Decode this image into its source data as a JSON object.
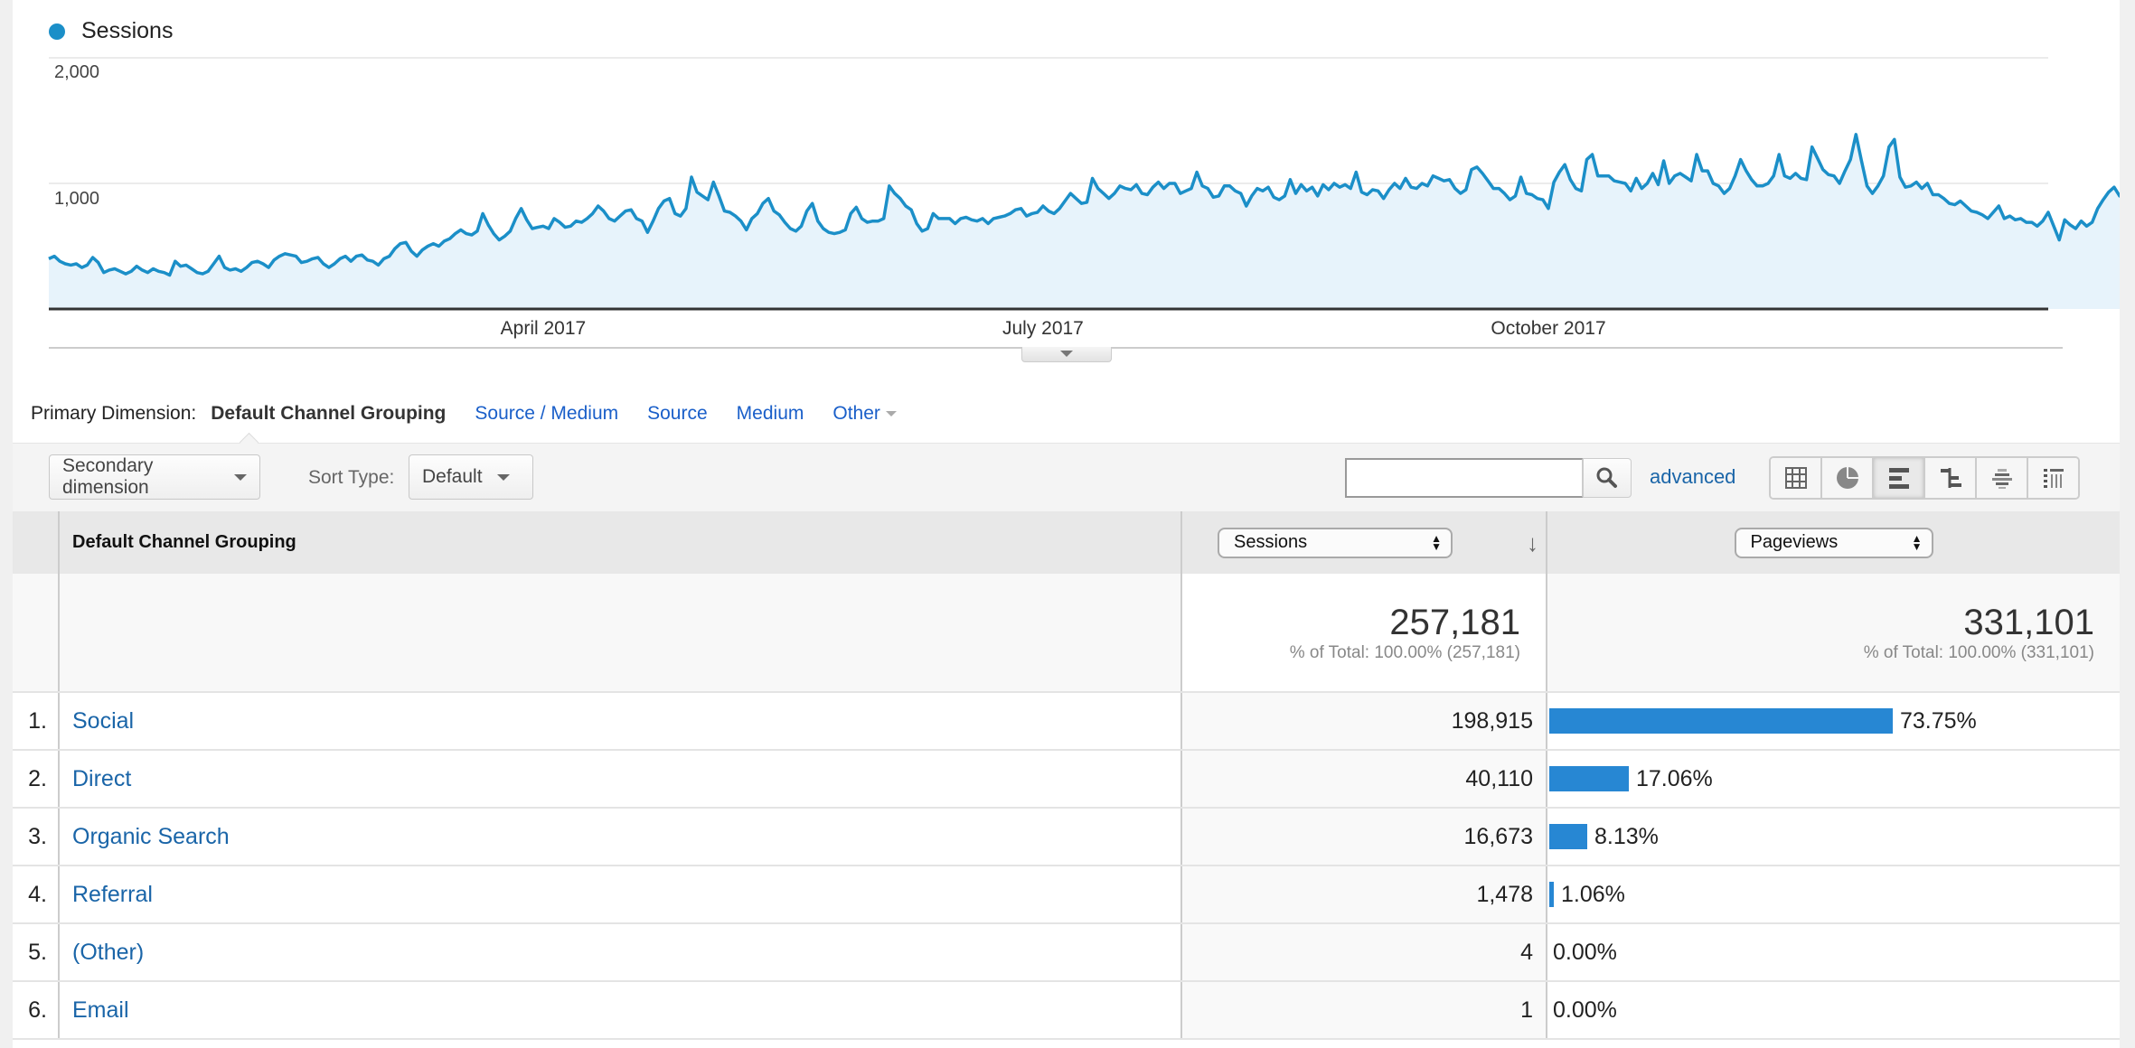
{
  "legend": {
    "label": "Sessions",
    "color": "#1b8fc8"
  },
  "chart_data": {
    "type": "area",
    "title": "",
    "xlabel": "",
    "ylabel": "",
    "series": [
      {
        "name": "Sessions",
        "color": "#1b8fc8",
        "fill": "#e7f3fb"
      }
    ],
    "x_start": "2017-01-01",
    "x_end": "2017-12-31",
    "x_ticks": [
      {
        "label": "April 2017",
        "day_index": 90
      },
      {
        "label": "July 2017",
        "day_index": 181
      },
      {
        "label": "October 2017",
        "day_index": 273
      }
    ],
    "y_ticks": [
      {
        "label": "1,000",
        "value": 1000
      },
      {
        "label": "2,000",
        "value": 2000
      }
    ],
    "ylim": [
      0,
      2000
    ],
    "grid": true,
    "legend_position": "top-left",
    "values": [
      400,
      420,
      380,
      360,
      350,
      360,
      330,
      350,
      410,
      370,
      290,
      310,
      320,
      300,
      280,
      300,
      340,
      310,
      290,
      320,
      300,
      290,
      270,
      380,
      340,
      350,
      320,
      290,
      280,
      300,
      360,
      420,
      330,
      310,
      320,
      300,
      330,
      370,
      380,
      360,
      330,
      390,
      420,
      440,
      430,
      420,
      370,
      380,
      400,
      410,
      360,
      330,
      360,
      400,
      420,
      380,
      420,
      430,
      390,
      380,
      350,
      400,
      420,
      480,
      520,
      530,
      460,
      420,
      470,
      500,
      520,
      500,
      540,
      560,
      600,
      630,
      600,
      590,
      620,
      760,
      670,
      600,
      550,
      580,
      620,
      720,
      800,
      710,
      640,
      650,
      660,
      640,
      720,
      690,
      650,
      660,
      700,
      690,
      720,
      760,
      820,
      780,
      720,
      700,
      740,
      780,
      790,
      720,
      700,
      610,
      700,
      800,
      860,
      880,
      760,
      740,
      800,
      1050,
      930,
      900,
      870,
      1010,
      900,
      780,
      770,
      740,
      700,
      630,
      720,
      760,
      840,
      880,
      780,
      750,
      690,
      640,
      620,
      660,
      780,
      840,
      700,
      640,
      610,
      600,
      610,
      630,
      760,
      810,
      720,
      690,
      700,
      700,
      720,
      980,
      920,
      880,
      820,
      790,
      680,
      620,
      640,
      760,
      720,
      720,
      720,
      680,
      720,
      730,
      710,
      700,
      720,
      680,
      720,
      730,
      740,
      760,
      790,
      800,
      740,
      760,
      770,
      820,
      780,
      760,
      800,
      860,
      920,
      880,
      840,
      850,
      1040,
      960,
      920,
      880,
      920,
      980,
      960,
      950,
      990,
      920,
      910,
      970,
      1010,
      960,
      1000,
      1000,
      920,
      940,
      960,
      1090,
      980,
      960,
      890,
      900,
      980,
      980,
      940,
      920,
      820,
      900,
      960,
      940,
      970,
      890,
      870,
      900,
      1030,
      920,
      990,
      940,
      970,
      900,
      990,
      950,
      1000,
      970,
      990,
      960,
      1090,
      930,
      910,
      950,
      940,
      880,
      950,
      1000,
      960,
      1040,
      970,
      960,
      1000,
      980,
      1060,
      1040,
      1020,
      1030,
      960,
      920,
      950,
      1110,
      1130,
      1080,
      1020,
      960,
      960,
      920,
      870,
      900,
      1050,
      920,
      910,
      880,
      870,
      800,
      1010,
      1090,
      1150,
      1030,
      960,
      940,
      1190,
      1230,
      1060,
      1060,
      1060,
      1020,
      1010,
      1000,
      940,
      1040,
      960,
      1000,
      1080,
      990,
      1180,
      1000,
      1060,
      1080,
      1050,
      1020,
      1230,
      1100,
      1100,
      1000,
      980,
      920,
      960,
      1060,
      1190,
      1100,
      1030,
      980,
      980,
      1000,
      1060,
      1230,
      1060,
      1040,
      1080,
      1040,
      1030,
      1290,
      1200,
      1110,
      1070,
      1060,
      1000,
      1100,
      1190,
      1390,
      1180,
      980,
      920,
      980,
      1060,
      1290,
      1350,
      1050,
      970,
      980,
      1010,
      960,
      1000,
      910,
      910,
      880,
      840,
      830,
      860,
      820,
      780,
      770,
      750,
      720,
      770,
      820,
      720,
      740,
      710,
      720,
      690,
      690,
      660,
      700,
      770,
      660,
      550,
      710,
      670,
      640,
      700,
      660,
      690,
      800,
      870,
      930,
      970,
      900,
      950,
      870
    ]
  },
  "dimension_bar": {
    "label": "Primary Dimension:",
    "active": "Default Channel Grouping",
    "options": [
      "Source / Medium",
      "Source",
      "Medium"
    ],
    "other": "Other"
  },
  "toolbar": {
    "secondary_dimension": "Secondary dimension",
    "sort_type_label": "Sort Type:",
    "sort_type_value": "Default",
    "search_value": "",
    "advanced": "advanced",
    "views": [
      {
        "name": "data-table-view",
        "active": false
      },
      {
        "name": "percentage-pie-view",
        "active": false
      },
      {
        "name": "performance-bar-view",
        "active": true
      },
      {
        "name": "comparison-view",
        "active": false
      },
      {
        "name": "term-cloud-view",
        "active": false
      },
      {
        "name": "pivot-view",
        "active": false
      }
    ]
  },
  "table": {
    "dimension_header": "Default Channel Grouping",
    "metric1_select": "Sessions",
    "metric2_select": "Pageviews",
    "bar_color": "#2787d3",
    "totals": {
      "sessions": "257,181",
      "sessions_pct": "% of Total: 100.00% (257,181)",
      "pageviews": "331,101",
      "pageviews_pct": "% of Total: 100.00% (331,101)"
    },
    "rows": [
      {
        "index": "1.",
        "name": "Social",
        "sessions": "198,915",
        "pageviews_pct": "73.75%",
        "pct_value": 73.75
      },
      {
        "index": "2.",
        "name": "Direct",
        "sessions": "40,110",
        "pageviews_pct": "17.06%",
        "pct_value": 17.06
      },
      {
        "index": "3.",
        "name": "Organic Search",
        "sessions": "16,673",
        "pageviews_pct": "8.13%",
        "pct_value": 8.13
      },
      {
        "index": "4.",
        "name": "Referral",
        "sessions": "1,478",
        "pageviews_pct": "1.06%",
        "pct_value": 1.06
      },
      {
        "index": "5.",
        "name": "(Other)",
        "sessions": "4",
        "pageviews_pct": "0.00%",
        "pct_value": 0
      },
      {
        "index": "6.",
        "name": "Email",
        "sessions": "1",
        "pageviews_pct": "0.00%",
        "pct_value": 0
      }
    ]
  }
}
